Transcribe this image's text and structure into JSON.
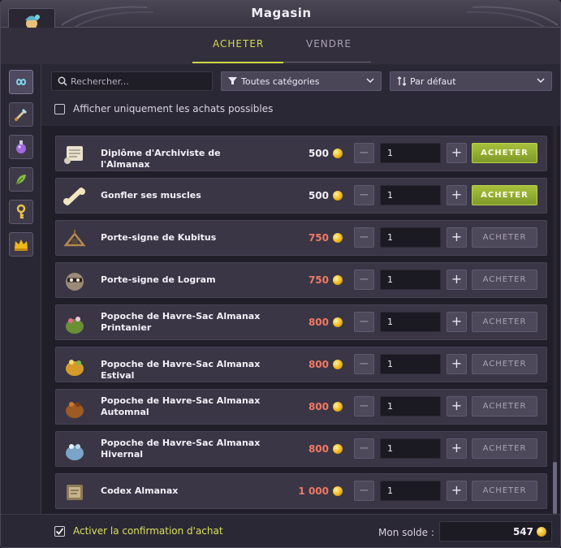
{
  "window": {
    "title": "Magasin"
  },
  "tabs": [
    {
      "label": "ACHETER",
      "active": true
    },
    {
      "label": "VENDRE",
      "active": false
    }
  ],
  "sidebar": {
    "categories": [
      {
        "icon": "infinity-icon",
        "active": true
      },
      {
        "icon": "sword-icon",
        "active": false
      },
      {
        "icon": "potion-icon",
        "active": false
      },
      {
        "icon": "leaf-icon",
        "active": false
      },
      {
        "icon": "key-icon",
        "active": false
      },
      {
        "icon": "crown-icon",
        "active": false
      }
    ]
  },
  "filters": {
    "search_placeholder": "Rechercher...",
    "category": "Toutes catégories",
    "sort": "Par défaut",
    "only_affordable_label": "Afficher uniquement les achats possibles",
    "only_affordable_checked": false
  },
  "items": [
    {
      "name": "Diplôme d'Archiviste de l'Almanax",
      "price": "500",
      "affordable": true,
      "qty": "1",
      "buy_label": "ACHETER",
      "icon": "scroll-icon"
    },
    {
      "name": "Gonfler ses muscles",
      "price": "500",
      "affordable": true,
      "qty": "1",
      "buy_label": "ACHETER",
      "icon": "bone-icon"
    },
    {
      "name": "Porte-signe de Kubitus",
      "price": "750",
      "affordable": false,
      "qty": "1",
      "buy_label": "ACHETER",
      "icon": "hanger-icon"
    },
    {
      "name": "Porte-signe de Logram",
      "price": "750",
      "affordable": false,
      "qty": "1",
      "buy_label": "ACHETER",
      "icon": "raccoon-icon"
    },
    {
      "name": "Popoche de Havre-Sac Almanax Printanier",
      "price": "800",
      "affordable": false,
      "qty": "1",
      "buy_label": "ACHETER",
      "icon": "bag-spring-icon"
    },
    {
      "name": "Popoche de Havre-Sac Almanax Estival",
      "price": "800",
      "affordable": false,
      "qty": "1",
      "buy_label": "ACHETER",
      "icon": "bag-summer-icon"
    },
    {
      "name": "Popoche de Havre-Sac Almanax Automnal",
      "price": "800",
      "affordable": false,
      "qty": "1",
      "buy_label": "ACHETER",
      "icon": "bag-autumn-icon"
    },
    {
      "name": "Popoche de Havre-Sac Almanax Hivernal",
      "price": "800",
      "affordable": false,
      "qty": "1",
      "buy_label": "ACHETER",
      "icon": "bag-winter-icon"
    },
    {
      "name": "Codex Almanax",
      "price": "1 000",
      "affordable": false,
      "qty": "1",
      "buy_label": "ACHETER",
      "icon": "codex-icon"
    }
  ],
  "stepper": {
    "minus": "−",
    "plus": "+"
  },
  "footer": {
    "confirm_label": "Activer la confirmation d'achat",
    "confirm_checked": true,
    "balance_label": "Mon solde :",
    "balance_value": "547"
  },
  "colors": {
    "accent": "#d4dc4a",
    "buy_enabled": "#8fab2f",
    "price_unaffordable": "#f07a63",
    "coin": "#f0b81a"
  }
}
